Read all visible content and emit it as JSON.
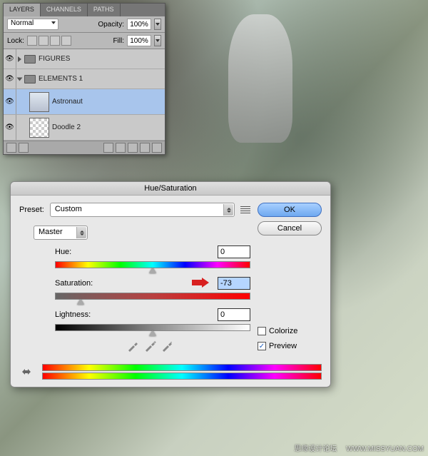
{
  "watermark": {
    "left": "思缘设计论坛",
    "right": "WWW.MISSYUAN.COM"
  },
  "layers_panel": {
    "tabs": [
      "LAYERS",
      "CHANNELS",
      "PATHS"
    ],
    "blend_mode": "Normal",
    "opacity_label": "Opacity:",
    "opacity_value": "100%",
    "lock_label": "Lock:",
    "fill_label": "Fill:",
    "fill_value": "100%",
    "layers": [
      {
        "name": "FIGURES",
        "type": "group",
        "expanded": false
      },
      {
        "name": "ELEMENTS 1",
        "type": "group",
        "expanded": true
      },
      {
        "name": "Astronaut",
        "type": "layer",
        "selected": true
      },
      {
        "name": "Doodle 2",
        "type": "layer",
        "selected": false
      }
    ]
  },
  "dialog": {
    "title": "Hue/Saturation",
    "preset_label": "Preset:",
    "preset_value": "Custom",
    "edit_value": "Master",
    "hue": {
      "label": "Hue:",
      "value": "0",
      "pos": 50
    },
    "saturation": {
      "label": "Saturation:",
      "value": "-73",
      "pos": 13
    },
    "lightness": {
      "label": "Lightness:",
      "value": "0",
      "pos": 50
    },
    "ok": "OK",
    "cancel": "Cancel",
    "colorize": "Colorize",
    "preview": "Preview",
    "preview_checked": true
  }
}
